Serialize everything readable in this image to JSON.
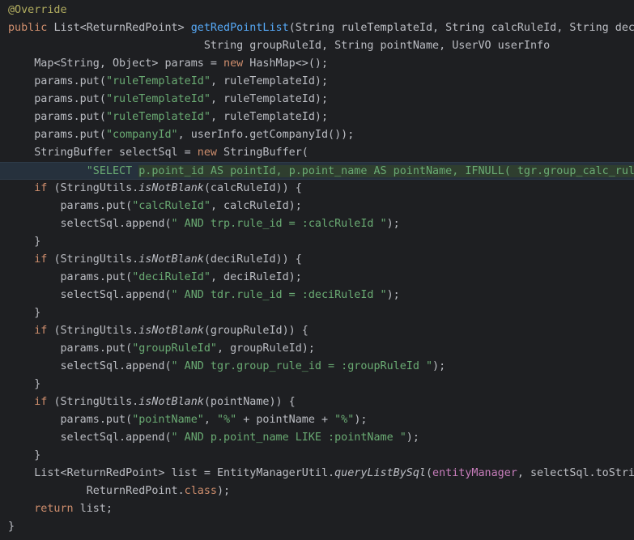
{
  "lines": [
    {
      "t": "@Override",
      "c": "ann"
    },
    {
      "parts": [
        [
          "public ",
          "kw"
        ],
        [
          "List<ReturnRedPoint> ",
          ""
        ],
        [
          "getRedPointList",
          "fn"
        ],
        [
          "(String ruleTemplateId, String calcRuleId, String deci",
          ""
        ]
      ]
    },
    {
      "parts": [
        [
          "                              String groupRuleId, String pointName, UserVO userInfo",
          ""
        ]
      ]
    },
    {
      "parts": [
        [
          "    Map<String, Object> params = ",
          ""
        ],
        [
          "new ",
          "kw"
        ],
        [
          "HashMap<>();",
          ""
        ]
      ]
    },
    {
      "parts": [
        [
          "    params.put(",
          ""
        ],
        [
          "\"ruleTemplateId\"",
          "str"
        ],
        [
          ", ruleTemplateId);",
          ""
        ]
      ]
    },
    {
      "parts": [
        [
          "    params.put(",
          ""
        ],
        [
          "\"ruleTemplateId\"",
          "str"
        ],
        [
          ", ruleTemplateId);",
          ""
        ]
      ]
    },
    {
      "parts": [
        [
          "    params.put(",
          ""
        ],
        [
          "\"ruleTemplateId\"",
          "str"
        ],
        [
          ", ruleTemplateId);",
          ""
        ]
      ]
    },
    {
      "parts": [
        [
          "    params.put(",
          ""
        ],
        [
          "\"companyId\"",
          "str"
        ],
        [
          ", userInfo.getCompanyId());",
          ""
        ]
      ]
    },
    {
      "parts": [
        [
          "    StringBuffer selectSql = ",
          ""
        ],
        [
          "new ",
          "kw"
        ],
        [
          "StringBuffer(",
          ""
        ]
      ]
    },
    {
      "highlight": true,
      "parts": [
        [
          "            ",
          ""
        ],
        [
          "\"SELECT ",
          "str"
        ],
        [
          "p.point_id AS pointId, ",
          "str sel"
        ],
        [
          "p.point_name AS pointName, ",
          "str sel"
        ],
        [
          "IFNULL( tgr.group_calc_rule",
          "str sel"
        ]
      ]
    },
    {
      "parts": [
        [
          "    ",
          ""
        ],
        [
          "if ",
          "kw"
        ],
        [
          "(StringUtils.",
          ""
        ],
        [
          "isNotBlank",
          "ital"
        ],
        [
          "(calcRuleId)) {",
          ""
        ]
      ]
    },
    {
      "parts": [
        [
          "        params.put(",
          ""
        ],
        [
          "\"calcRuleId\"",
          "str"
        ],
        [
          ", calcRuleId);",
          ""
        ]
      ]
    },
    {
      "parts": [
        [
          "        selectSql.append(",
          ""
        ],
        [
          "\" AND trp.rule_id = :calcRuleId \"",
          "str"
        ],
        [
          ");",
          ""
        ]
      ]
    },
    {
      "parts": [
        [
          "    }",
          ""
        ]
      ]
    },
    {
      "parts": [
        [
          "    ",
          ""
        ],
        [
          "if ",
          "kw"
        ],
        [
          "(StringUtils.",
          ""
        ],
        [
          "isNotBlank",
          "ital"
        ],
        [
          "(deciRuleId)) {",
          ""
        ]
      ]
    },
    {
      "parts": [
        [
          "        params.put(",
          ""
        ],
        [
          "\"deciRuleId\"",
          "str"
        ],
        [
          ", deciRuleId);",
          ""
        ]
      ]
    },
    {
      "parts": [
        [
          "        selectSql.append(",
          ""
        ],
        [
          "\" AND tdr.rule_id = :deciRuleId \"",
          "str"
        ],
        [
          ");",
          ""
        ]
      ]
    },
    {
      "parts": [
        [
          "    }",
          ""
        ]
      ]
    },
    {
      "parts": [
        [
          "    ",
          ""
        ],
        [
          "if ",
          "kw"
        ],
        [
          "(StringUtils.",
          ""
        ],
        [
          "isNotBlank",
          "ital"
        ],
        [
          "(groupRuleId)) {",
          ""
        ]
      ]
    },
    {
      "parts": [
        [
          "        params.put(",
          ""
        ],
        [
          "\"groupRuleId\"",
          "str"
        ],
        [
          ", groupRuleId);",
          ""
        ]
      ]
    },
    {
      "parts": [
        [
          "        selectSql.append(",
          ""
        ],
        [
          "\" AND tgr.group_rule_id = :groupRuleId \"",
          "str"
        ],
        [
          ");",
          ""
        ]
      ]
    },
    {
      "parts": [
        [
          "    }",
          ""
        ]
      ]
    },
    {
      "parts": [
        [
          "    ",
          ""
        ],
        [
          "if ",
          "kw"
        ],
        [
          "(StringUtils.",
          ""
        ],
        [
          "isNotBlank",
          "ital"
        ],
        [
          "(pointName)) {",
          ""
        ]
      ]
    },
    {
      "parts": [
        [
          "        params.put(",
          ""
        ],
        [
          "\"pointName\"",
          "str"
        ],
        [
          ", ",
          ""
        ],
        [
          "\"%\"",
          "str"
        ],
        [
          " + pointName + ",
          ""
        ],
        [
          "\"%\"",
          "str"
        ],
        [
          ");",
          ""
        ]
      ]
    },
    {
      "parts": [
        [
          "        selectSql.append(",
          ""
        ],
        [
          "\" AND p.point_name LIKE :pointName \"",
          "str"
        ],
        [
          ");",
          ""
        ]
      ]
    },
    {
      "parts": [
        [
          "    }",
          ""
        ]
      ]
    },
    {
      "parts": [
        [
          "    List<ReturnRedPoint> list = EntityManagerUtil.",
          ""
        ],
        [
          "queryListBySql",
          "ital"
        ],
        [
          "(",
          ""
        ],
        [
          "entityManager",
          "fld"
        ],
        [
          ", selectSql.toStrin",
          ""
        ]
      ]
    },
    {
      "parts": [
        [
          "            ReturnRedPoint.",
          ""
        ],
        [
          "class",
          "kw"
        ],
        [
          ");",
          ""
        ]
      ]
    },
    {
      "parts": [
        [
          "    ",
          ""
        ],
        [
          "return ",
          "kw"
        ],
        [
          "list;",
          ""
        ]
      ]
    },
    {
      "parts": [
        [
          "}",
          ""
        ]
      ]
    }
  ]
}
